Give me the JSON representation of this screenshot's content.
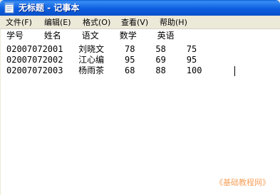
{
  "window": {
    "title": "无标题 - 记事本"
  },
  "menubar": {
    "items": [
      {
        "label": "文件(F)"
      },
      {
        "label": "编辑(E)"
      },
      {
        "label": "格式(O)"
      },
      {
        "label": "查看(V)"
      },
      {
        "label": "帮助(H)"
      }
    ]
  },
  "document": {
    "lines": [
      "学号    姓名    语文    数学    英语",
      "02007072001   刘晓文    78    58    75",
      "02007072002   江心编    95    69    95",
      "02007072003   杨雨茶    68    88    100"
    ]
  },
  "watermark": "《基础教程网》",
  "icons": {
    "app": "notepad-icon"
  },
  "colors": {
    "titlebar": "#0a5fd8",
    "watermark": "#f5a05a"
  }
}
